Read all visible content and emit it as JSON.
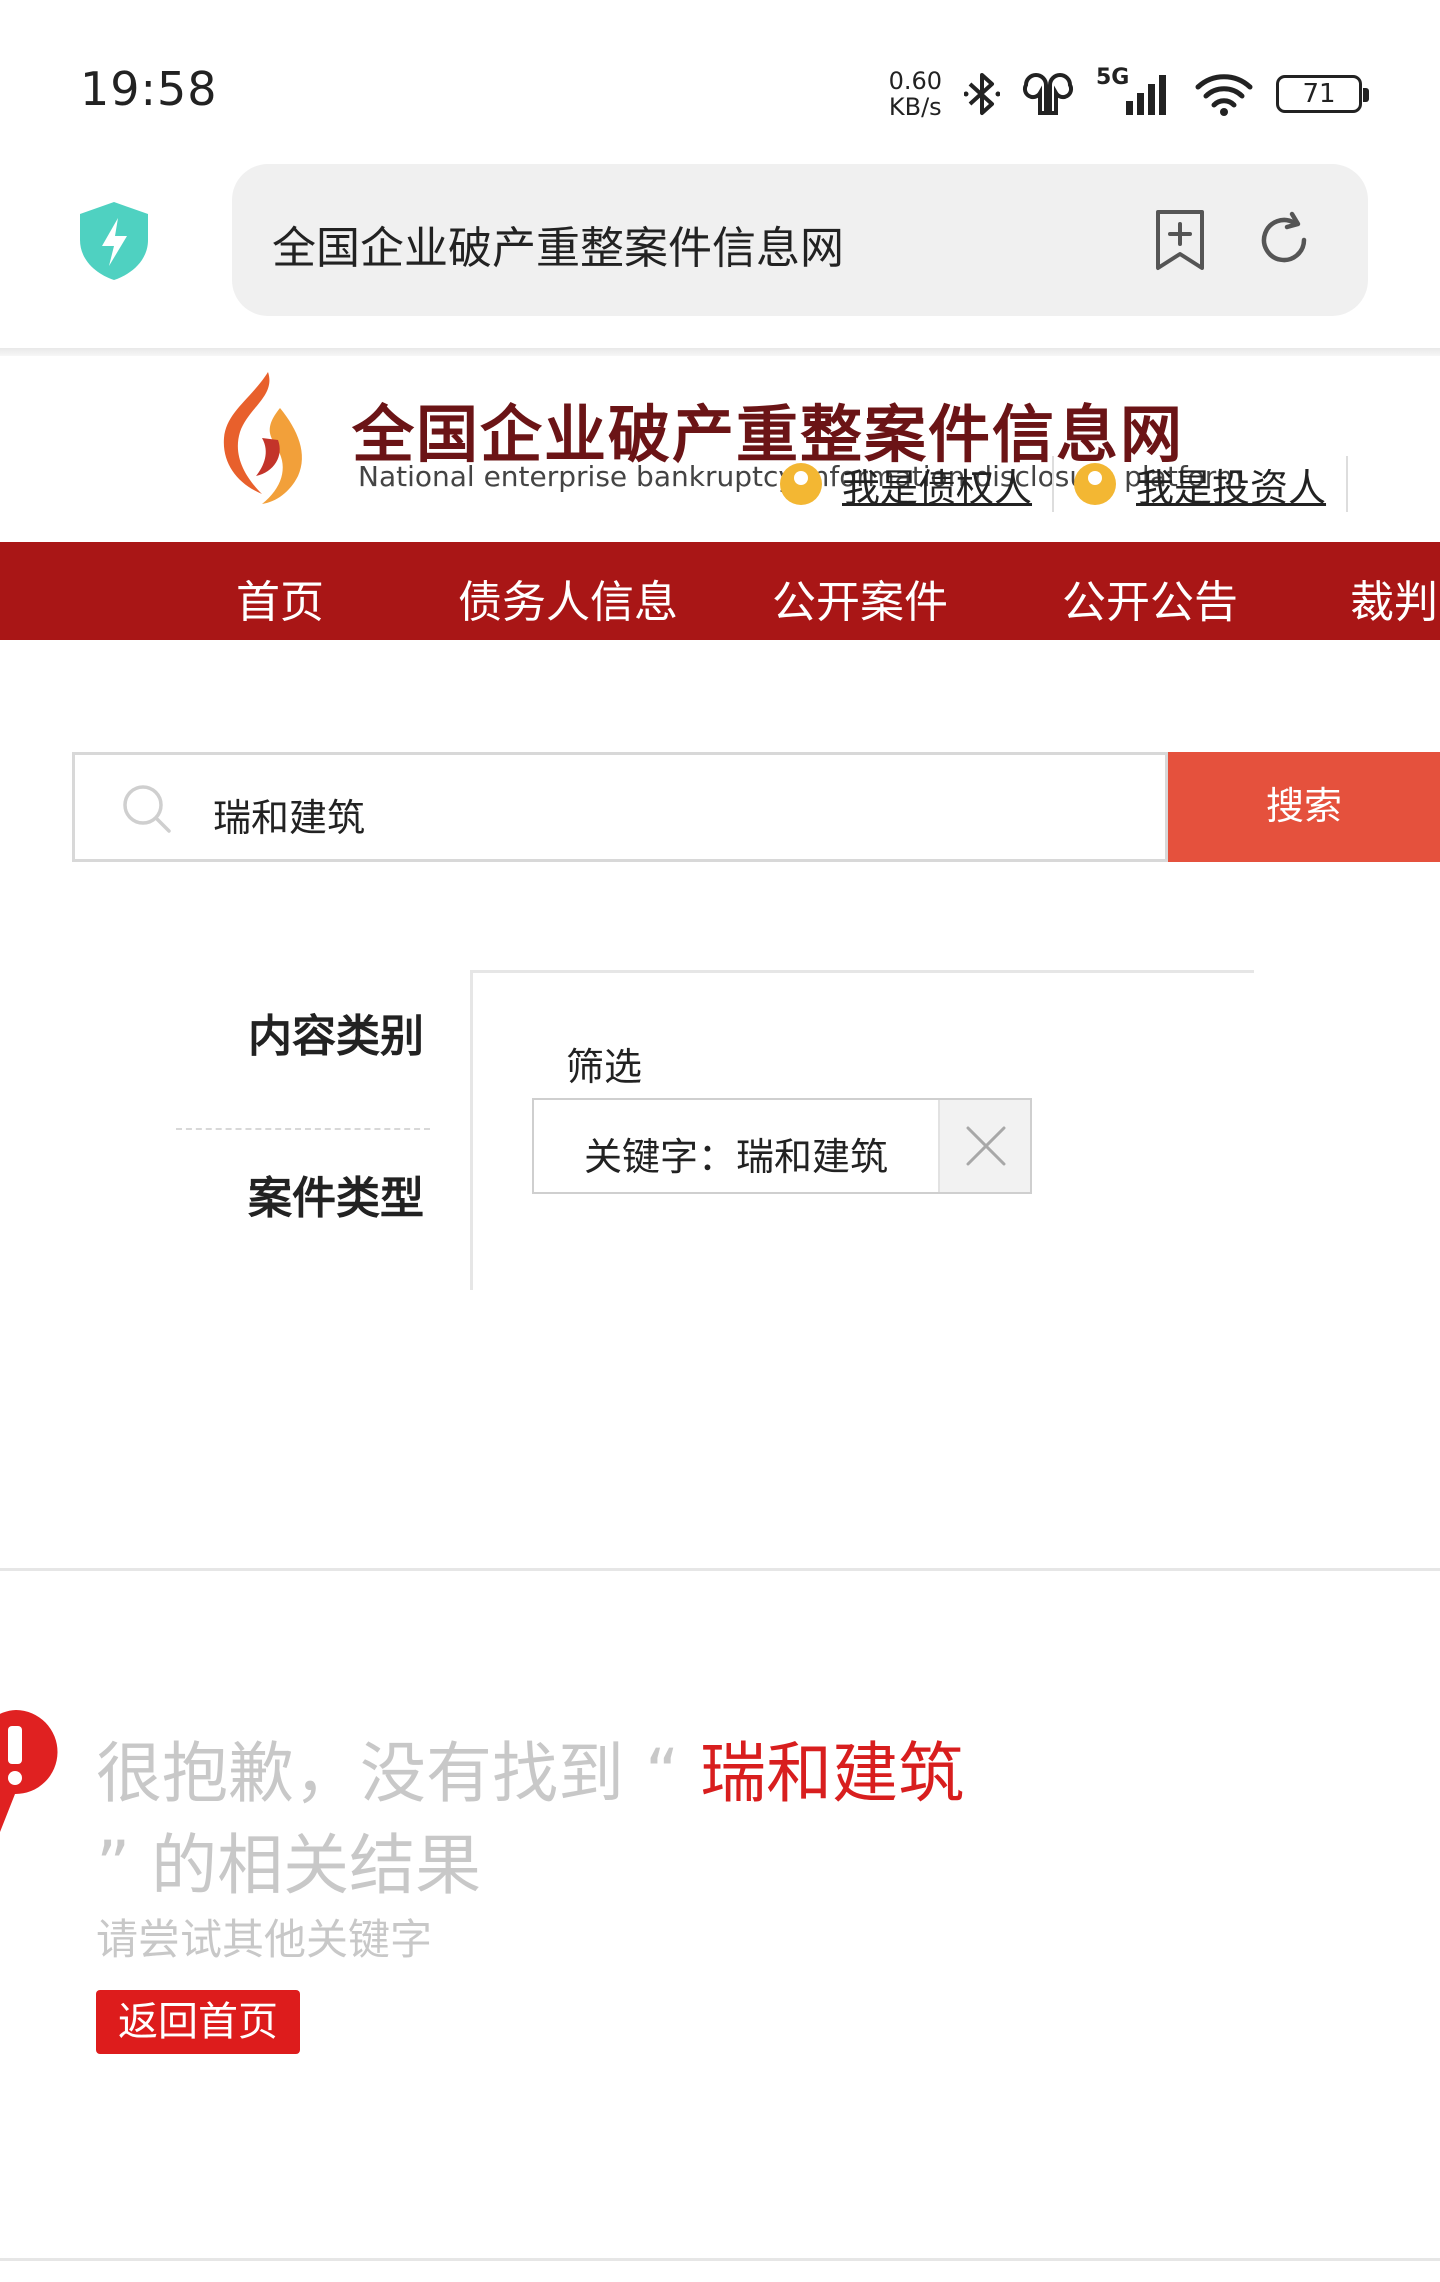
{
  "status_bar": {
    "time": "19:58",
    "net_speed_value": "0.60",
    "net_speed_unit": "KB/s",
    "network": "5G",
    "battery": "71"
  },
  "browser": {
    "url_title": "全国企业破产重整案件信息网"
  },
  "site": {
    "title": "全国企业破产重整案件信息网",
    "subtitle": "National enterprise bankruptcy  information disclosure platform",
    "link_creditor": "我是债权人",
    "link_investor": "我是投资人"
  },
  "nav": {
    "items": [
      {
        "label": "首页"
      },
      {
        "label": "债务人信息"
      },
      {
        "label": "公开案件"
      },
      {
        "label": "公开公告"
      },
      {
        "label": "裁判"
      }
    ]
  },
  "search": {
    "value": "瑞和建筑",
    "button_label": "搜索"
  },
  "filters": {
    "content_type_label": "内容类别",
    "case_type_label": "案件类型",
    "title": "筛选",
    "tag_label": "关键字：瑞和建筑"
  },
  "no_result": {
    "prefix": "很抱歉，没有找到 “ ",
    "keyword": "瑞和建筑",
    "suffix": "” 的相关结果",
    "hint": "请尝试其他关键字",
    "home_button": "返回首页"
  },
  "colors": {
    "brand_red": "#a91616",
    "search_button": "#e5513d",
    "keyword_red": "#d81e1e"
  }
}
